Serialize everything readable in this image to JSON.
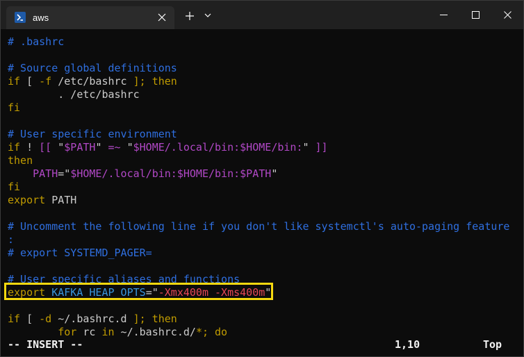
{
  "window": {
    "tab_title": "aws",
    "tab_icon": "powershell-icon",
    "controls": [
      "minimize",
      "maximize",
      "close"
    ]
  },
  "editor": {
    "lines": [
      [
        {
          "t": "# .bashrc",
          "c": "comment"
        }
      ],
      [
        {
          "t": "",
          "c": "text"
        }
      ],
      [
        {
          "t": "# Source global definitions",
          "c": "comment"
        }
      ],
      [
        {
          "t": "if",
          "c": "kw"
        },
        {
          "t": " [ ",
          "c": "text"
        },
        {
          "t": "-f",
          "c": "kw"
        },
        {
          "t": " /etc/bashrc ",
          "c": "text"
        },
        {
          "t": "];",
          "c": "kw"
        },
        {
          "t": " ",
          "c": "text"
        },
        {
          "t": "then",
          "c": "kw"
        }
      ],
      [
        {
          "t": "        . /etc/bashrc",
          "c": "text"
        }
      ],
      [
        {
          "t": "fi",
          "c": "kw"
        }
      ],
      [
        {
          "t": "",
          "c": "text"
        }
      ],
      [
        {
          "t": "# User specific environment",
          "c": "comment"
        }
      ],
      [
        {
          "t": "if",
          "c": "kw"
        },
        {
          "t": " ! ",
          "c": "text"
        },
        {
          "t": "[[",
          "c": "var"
        },
        {
          "t": " \"",
          "c": "text"
        },
        {
          "t": "$PATH",
          "c": "var"
        },
        {
          "t": "\" ",
          "c": "text"
        },
        {
          "t": "=~",
          "c": "var"
        },
        {
          "t": " \"",
          "c": "text"
        },
        {
          "t": "$HOME",
          "c": "var"
        },
        {
          "t": "/.local/bin:",
          "c": "var"
        },
        {
          "t": "$HOME",
          "c": "var"
        },
        {
          "t": "/bin:",
          "c": "var"
        },
        {
          "t": "\" ",
          "c": "text"
        },
        {
          "t": "]]",
          "c": "var"
        }
      ],
      [
        {
          "t": "then",
          "c": "kw"
        }
      ],
      [
        {
          "t": "    ",
          "c": "text"
        },
        {
          "t": "PATH",
          "c": "var"
        },
        {
          "t": "=\"",
          "c": "text"
        },
        {
          "t": "$HOME",
          "c": "var"
        },
        {
          "t": "/.local/bin:",
          "c": "var"
        },
        {
          "t": "$HOME",
          "c": "var"
        },
        {
          "t": "/bin:",
          "c": "var"
        },
        {
          "t": "$PATH",
          "c": "var"
        },
        {
          "t": "\"",
          "c": "text"
        }
      ],
      [
        {
          "t": "fi",
          "c": "kw"
        }
      ],
      [
        {
          "t": "export",
          "c": "kw"
        },
        {
          "t": " PATH",
          "c": "text"
        }
      ],
      [
        {
          "t": "",
          "c": "text"
        }
      ],
      [
        {
          "t": "# Uncomment the following line if you don't like systemctl's auto-paging feature",
          "c": "comment"
        }
      ],
      [
        {
          "t": ":",
          "c": "comment"
        }
      ],
      [
        {
          "t": "# export SYSTEMD_PAGER=",
          "c": "comment"
        }
      ],
      [
        {
          "t": "",
          "c": "text"
        }
      ],
      [
        {
          "t": "# User specific aliases and functions",
          "c": "comment"
        }
      ],
      [
        {
          "t": "export",
          "c": "kw"
        },
        {
          "t": " ",
          "c": "text"
        },
        {
          "t": "KAFKA_HEAP_OPTS",
          "c": "ident"
        },
        {
          "t": "=\"",
          "c": "text"
        },
        {
          "t": "-Xmx400m -Xms400m",
          "c": "str"
        },
        {
          "t": "\"",
          "c": "text"
        }
      ],
      [
        {
          "t": "",
          "c": "text"
        }
      ],
      [
        {
          "t": "if",
          "c": "kw"
        },
        {
          "t": " [ ",
          "c": "text"
        },
        {
          "t": "-d",
          "c": "kw"
        },
        {
          "t": " ~/.bashrc.d ",
          "c": "text"
        },
        {
          "t": "];",
          "c": "kw"
        },
        {
          "t": " ",
          "c": "text"
        },
        {
          "t": "then",
          "c": "kw"
        }
      ],
      [
        {
          "t": "        ",
          "c": "text"
        },
        {
          "t": "for",
          "c": "kw"
        },
        {
          "t": " rc ",
          "c": "text"
        },
        {
          "t": "in",
          "c": "kw"
        },
        {
          "t": " ~/.bashrc.d/",
          "c": "text"
        },
        {
          "t": "*;",
          "c": "kw"
        },
        {
          "t": " ",
          "c": "text"
        },
        {
          "t": "do",
          "c": "kw"
        }
      ]
    ]
  },
  "status": {
    "mode": "-- INSERT --",
    "cursor": "1,10",
    "scroll": "Top"
  },
  "colors": {
    "comment": "#2f6fe0",
    "keyword": "#c19c00",
    "text": "#cccccc",
    "variable": "#b148c6",
    "string": "#e74856",
    "identifier": "#3a96dd",
    "highlight": "#f5d80f"
  }
}
